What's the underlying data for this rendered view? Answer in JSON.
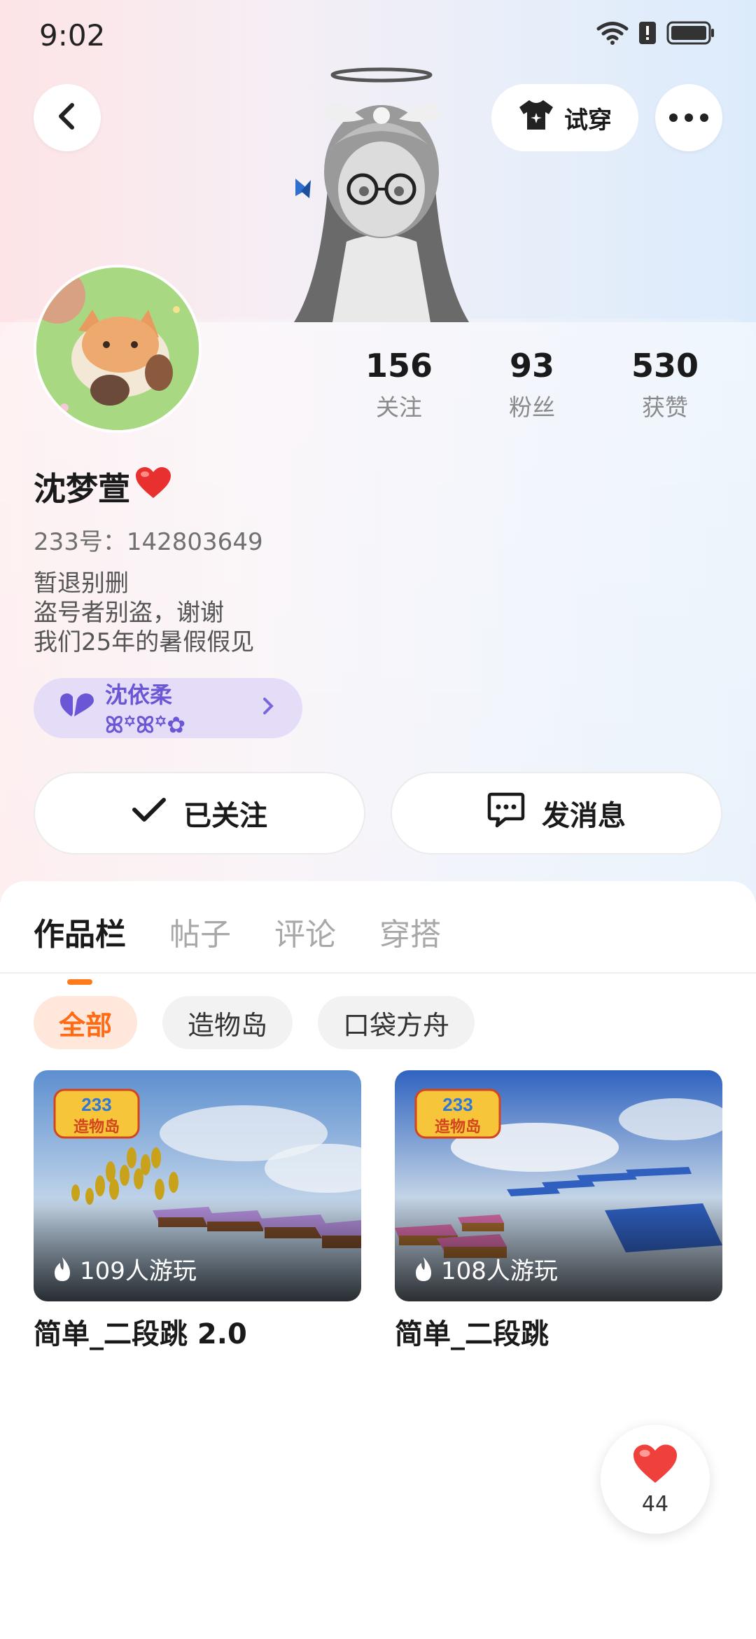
{
  "status_bar": {
    "time": "9:02"
  },
  "header": {
    "try_on_label": "试穿"
  },
  "stats": [
    {
      "value": "156",
      "label": "关注"
    },
    {
      "value": "93",
      "label": "粉丝"
    },
    {
      "value": "530",
      "label": "获赞"
    }
  ],
  "profile": {
    "username": "沈梦萱",
    "id_line": "233号：142803649",
    "bio_lines": [
      "暂退别删",
      "盗号者别盗，谢谢",
      "我们25年的暑假假见"
    ],
    "bond_name": "沈依柔ꕤ꙳ꕤ꙳✿"
  },
  "actions": {
    "follow": "已关注",
    "message": "发消息"
  },
  "tabs": [
    "作品栏",
    "帖子",
    "评论",
    "穿搭"
  ],
  "filters": [
    "全部",
    "造物岛",
    "口袋方舟"
  ],
  "works": [
    {
      "badge_top": "233",
      "badge_bottom": "造物岛",
      "plays": "109人游玩",
      "title": "简单_二段跳 2.0"
    },
    {
      "badge_top": "233",
      "badge_bottom": "造物岛",
      "plays": "108人游玩",
      "title": "简单_二段跳"
    }
  ],
  "like_count": "44",
  "colors": {
    "accent": "#ff6a13",
    "bond_bg": "#e5ddf8",
    "bond_text": "#6b57d6"
  }
}
